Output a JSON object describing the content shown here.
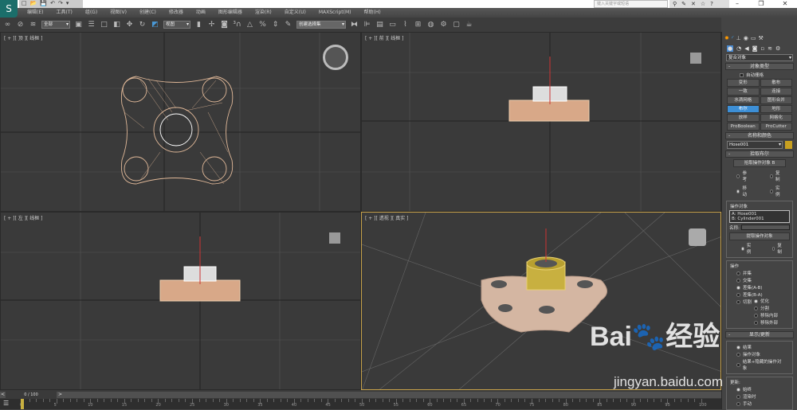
{
  "quick_access": [
    "□",
    "📂",
    "💾",
    "↶",
    "↷",
    "▾"
  ],
  "search": {
    "placeholder": "键入关键字或短语"
  },
  "window_buttons": [
    "–",
    "❐",
    "✕"
  ],
  "menu": [
    "编辑(E)",
    "工具(T)",
    "组(G)",
    "视图(V)",
    "创建(C)",
    "修改器",
    "动画",
    "图形编辑器",
    "渲染(R)",
    "自定义(U)",
    "MAXScript(M)",
    "帮助(H)"
  ],
  "toolbar": {
    "selection_filter": "全部",
    "ref_coord": "视图",
    "named_selection": "创建选择集"
  },
  "viewports": {
    "top": "[ + ][ 顶 ][ 线框 ]",
    "front": "[ + ][ 前 ][ 线框 ]",
    "left": "[ + ][ 左 ][ 线框 ]",
    "persp": "[ + ][ 透视 ][ 真实 ]"
  },
  "command_panel": {
    "category": "复合对象",
    "object_type": {
      "title": "对象类型",
      "autogrid": "自动栅格",
      "buttons": [
        "变形",
        "散布",
        "一致",
        "连接",
        "水滴网格",
        "图形合并",
        "布尔",
        "地形",
        "放样",
        "网格化",
        "ProBoolean",
        "ProCutter"
      ],
      "active": "布尔"
    },
    "name_color": {
      "title": "名称和颜色",
      "name": "Hose001",
      "color": "#c8a020"
    },
    "pick_boolean": {
      "title": "拾取布尔",
      "pick_button": "拾取操作对象 B",
      "options": [
        "参考",
        "复制",
        "移动",
        "实例"
      ],
      "selected": "移动"
    },
    "operands": {
      "title": "操作对象",
      "items": [
        "A: Hose001",
        "B: Cylinder001"
      ],
      "name_label": "名称:",
      "extract_button": "提取操作对象",
      "extract_options": [
        "实例",
        "复制"
      ],
      "extract_selected": "实例"
    },
    "operation": {
      "title": "操作",
      "options": [
        "并集",
        "交集",
        "差集(A-B)",
        "差集(B-A)",
        "切割"
      ],
      "selected": "差集(A-B)",
      "cut_options": [
        "优化",
        "分割",
        "移除内部",
        "移除外部"
      ],
      "cut_selected": "优化"
    },
    "display_update": {
      "title": "显示/更新",
      "display_options": [
        "结果",
        "操作对象",
        "结果+隐藏的操作对象"
      ],
      "display_selected": "结果",
      "update_label": "更新:",
      "update_options": [
        "始终",
        "渲染时",
        "手动"
      ],
      "update_selected": "始终"
    }
  },
  "timeline": {
    "frame": "0 / 100",
    "labels": [
      "0",
      "5",
      "10",
      "15",
      "20",
      "25",
      "30",
      "35",
      "40",
      "45",
      "50",
      "55",
      "60",
      "65",
      "70",
      "75",
      "80",
      "85",
      "90",
      "95",
      "100"
    ]
  },
  "watermark": {
    "brand": "Bai du 经验",
    "url": "jingyan.baidu.com"
  }
}
